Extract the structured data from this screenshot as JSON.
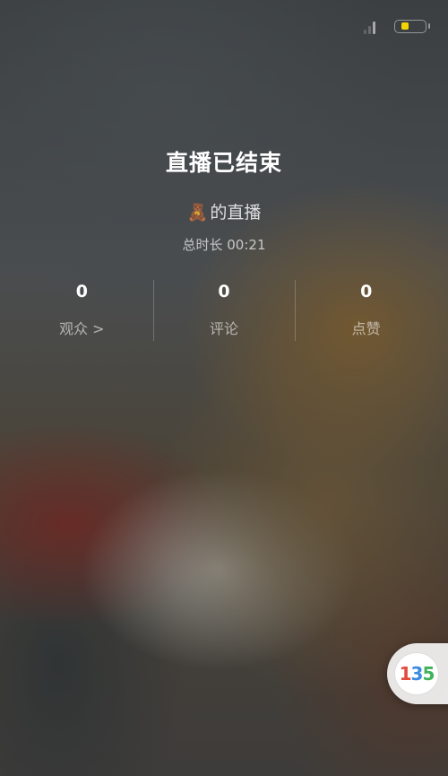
{
  "status_bar": {
    "signal_icon": "signal-bars-icon",
    "battery_icon": "battery-icon",
    "battery_level": 0.2,
    "battery_color": "#f2d400"
  },
  "live_end": {
    "title": "直播已结束",
    "host_avatar_emoji": "🧸",
    "host_suffix": "的直播",
    "duration": "总时长 00:21"
  },
  "stats": [
    {
      "value": "0",
      "label": "观众 >"
    },
    {
      "value": "0",
      "label": "评论"
    },
    {
      "value": "0",
      "label": "点赞"
    }
  ],
  "floating_widget": {
    "logo_text": "135",
    "logo_colors": [
      "#e24a3b",
      "#3b8be2",
      "#3fb25a"
    ]
  }
}
